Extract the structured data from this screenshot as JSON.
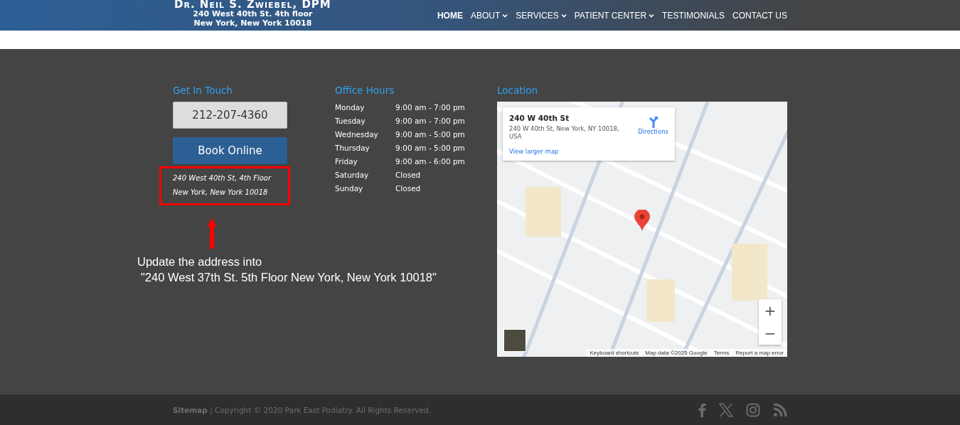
{
  "header": {
    "logo": {
      "name": "Dr. Neil S. Zwiebel, DPM",
      "line_1": "240 West 40th St. 4th floor",
      "line_2": "New York, New York 10018"
    },
    "nav": [
      {
        "label": "HOME",
        "selected": true,
        "dropdown": false
      },
      {
        "label": "ABOUT",
        "selected": false,
        "dropdown": true
      },
      {
        "label": "SERVICES",
        "selected": false,
        "dropdown": true
      },
      {
        "label": "PATIENT CENTER",
        "selected": false,
        "dropdown": true
      },
      {
        "label": "TESTIMONIALS",
        "selected": false,
        "dropdown": false
      },
      {
        "label": "CONTACT US",
        "selected": false,
        "dropdown": false
      }
    ]
  },
  "contact": {
    "heading": "Get In Touch",
    "phone": "212-207-4360",
    "book_button": "Book Online",
    "address": [
      "240 West 40th St, 4th Floor",
      "New York, New York 10018"
    ]
  },
  "hours": {
    "heading": "Office Hours",
    "rows": [
      {
        "day": "Monday",
        "time": "9:00 am - 7:00 pm"
      },
      {
        "day": "Tuesday",
        "time": "9:00 am - 7:00 pm"
      },
      {
        "day": "Wednesday",
        "time": "9:00 am - 5:00 pm"
      },
      {
        "day": "Thursday",
        "time": "9:00 am - 5:00 pm"
      },
      {
        "day": "Friday",
        "time": "9:00 am - 6:00 pm"
      },
      {
        "day": "Saturday",
        "time": "Closed"
      },
      {
        "day": "Sunday",
        "time": "Closed"
      }
    ]
  },
  "location": {
    "heading": "Location",
    "map": {
      "place_title": "240 W 40th St",
      "place_address": "240 W 40th St, New York, NY 10018, USA",
      "directions": "Directions",
      "view_larger": "View larger map",
      "zoom_in": "+",
      "zoom_out": "−",
      "attribution": [
        "Keyboard shortcuts",
        "Map data ©2025 Google",
        "Terms",
        "Report a map error"
      ]
    }
  },
  "annotation": {
    "lines": [
      "Update the address into",
      "\"240 West 37th St. 5th Floor New York, New York 10018\""
    ]
  },
  "footer": {
    "sitemap": "Sitemap",
    "copyright": "| Copyright © 2020 Park East Podiatry. All Rights Reserved.",
    "social": [
      {
        "kind": "facebook"
      },
      {
        "kind": "x"
      },
      {
        "kind": "instagram"
      },
      {
        "kind": "rss"
      }
    ]
  }
}
